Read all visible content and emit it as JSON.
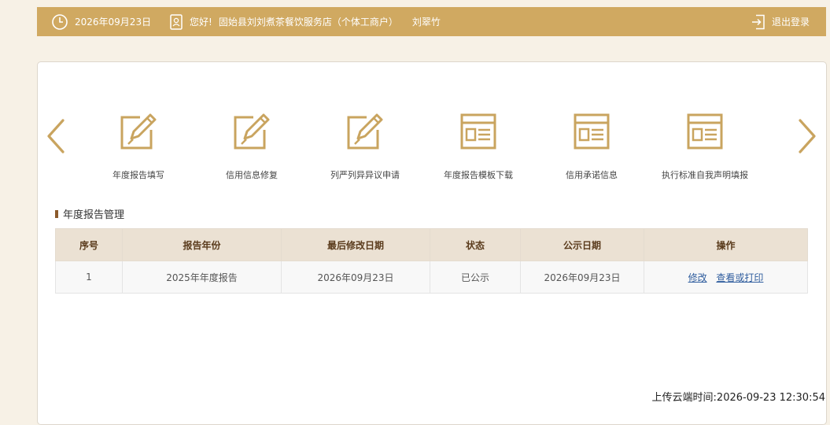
{
  "header": {
    "date": "2026年09月23日",
    "greeting": "您好!",
    "store_name": "固始县刘刘煮茶餐饮服务店（个体工商户）",
    "user_name": "刘翠竹",
    "logout_label": "退出登录"
  },
  "carousel": {
    "prev_icon": "chevron-left-icon",
    "next_icon": "chevron-right-icon",
    "items": [
      {
        "label": "年度报告填写",
        "icon": "edit-icon"
      },
      {
        "label": "信用信息修复",
        "icon": "edit-icon"
      },
      {
        "label": "列严列异异议申请",
        "icon": "edit-icon"
      },
      {
        "label": "年度报告模板下载",
        "icon": "document-icon"
      },
      {
        "label": "信用承诺信息",
        "icon": "document-icon"
      },
      {
        "label": "执行标准自我声明填报",
        "icon": "document-icon"
      }
    ]
  },
  "section": {
    "title": "年度报告管理"
  },
  "table": {
    "columns": [
      "序号",
      "报告年份",
      "最后修改日期",
      "状态",
      "公示日期",
      "操作"
    ],
    "rows": [
      {
        "index": "1",
        "year": "2025年年度报告",
        "modified": "2026年09月23日",
        "status": "已公示",
        "publish_date": "2026年09月23日",
        "actions": {
          "edit": "修改",
          "view": "查看或打印"
        }
      }
    ]
  },
  "footer": {
    "upload_time": "上传云端时间:2026-09-23 12:30:54"
  },
  "colors": {
    "accent": "#d0a961",
    "table_header": "#ebe1d3",
    "link": "#2f5d9e"
  }
}
